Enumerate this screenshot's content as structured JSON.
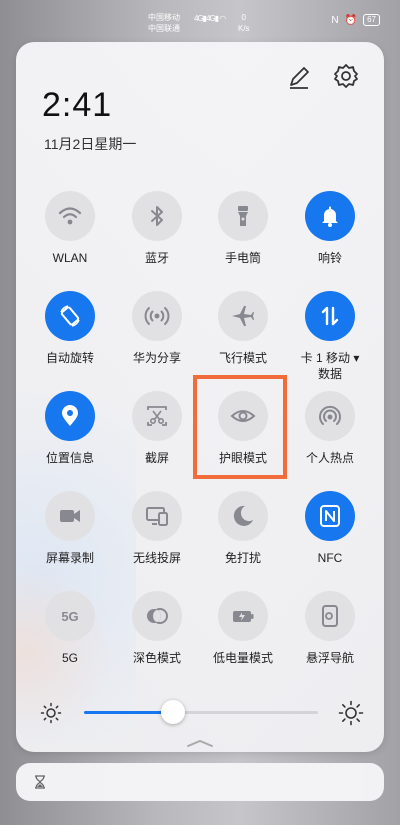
{
  "status_bar": {
    "carrier_1": "中国移动",
    "carrier_2": "中国联通",
    "signal_1": "4G",
    "signal_2": "4G",
    "speed_value": "0",
    "speed_unit": "K/s",
    "nfc": "N",
    "battery": "67"
  },
  "header": {
    "time": "2:41",
    "date": "11月2日星期一"
  },
  "tiles": [
    {
      "id": "wlan",
      "label": "WLAN",
      "icon": "wifi-icon",
      "on": false
    },
    {
      "id": "bluetooth",
      "label": "蓝牙",
      "icon": "bluetooth-icon",
      "on": false
    },
    {
      "id": "flashlight",
      "label": "手电筒",
      "icon": "flashlight-icon",
      "on": false
    },
    {
      "id": "ring",
      "label": "响铃",
      "icon": "bell-icon",
      "on": true
    },
    {
      "id": "auto-rotate",
      "label": "自动旋转",
      "icon": "rotate-icon",
      "on": true
    },
    {
      "id": "huawei-share",
      "label": "华为分享",
      "icon": "share-signal-icon",
      "on": false
    },
    {
      "id": "airplane",
      "label": "飞行模式",
      "icon": "airplane-icon",
      "on": false
    },
    {
      "id": "mobile-data",
      "label": "卡 1 移动 ▾",
      "label2": "数据",
      "icon": "data-arrows-icon",
      "on": true
    },
    {
      "id": "location",
      "label": "位置信息",
      "icon": "location-pin-icon",
      "on": true
    },
    {
      "id": "screenshot",
      "label": "截屏",
      "icon": "scissors-screenshot-icon",
      "on": false
    },
    {
      "id": "eye-comfort",
      "label": "护眼模式",
      "icon": "eye-icon",
      "on": false
    },
    {
      "id": "hotspot",
      "label": "个人热点",
      "icon": "hotspot-icon",
      "on": false
    },
    {
      "id": "screen-record",
      "label": "屏幕录制",
      "icon": "video-camera-icon",
      "on": false
    },
    {
      "id": "wireless-projection",
      "label": "无线投屏",
      "icon": "projection-icon",
      "on": false
    },
    {
      "id": "dnd",
      "label": "免打扰",
      "icon": "moon-icon",
      "on": false
    },
    {
      "id": "nfc",
      "label": "NFC",
      "icon": "nfc-icon",
      "on": true
    },
    {
      "id": "5g",
      "label": "5G",
      "icon": "5g-icon",
      "on": false
    },
    {
      "id": "dark-mode",
      "label": "深色模式",
      "icon": "dark-mode-icon",
      "on": false
    },
    {
      "id": "power-saving",
      "label": "低电量模式",
      "icon": "battery-saver-icon",
      "on": false
    },
    {
      "id": "floating-nav",
      "label": "悬浮导航",
      "icon": "floating-nav-icon",
      "on": false
    }
  ],
  "brightness": {
    "level_fraction": 0.38
  },
  "colors": {
    "accent": "#1677ee",
    "tile_off": "#e1e1e4",
    "highlight": "#f26b3a"
  }
}
